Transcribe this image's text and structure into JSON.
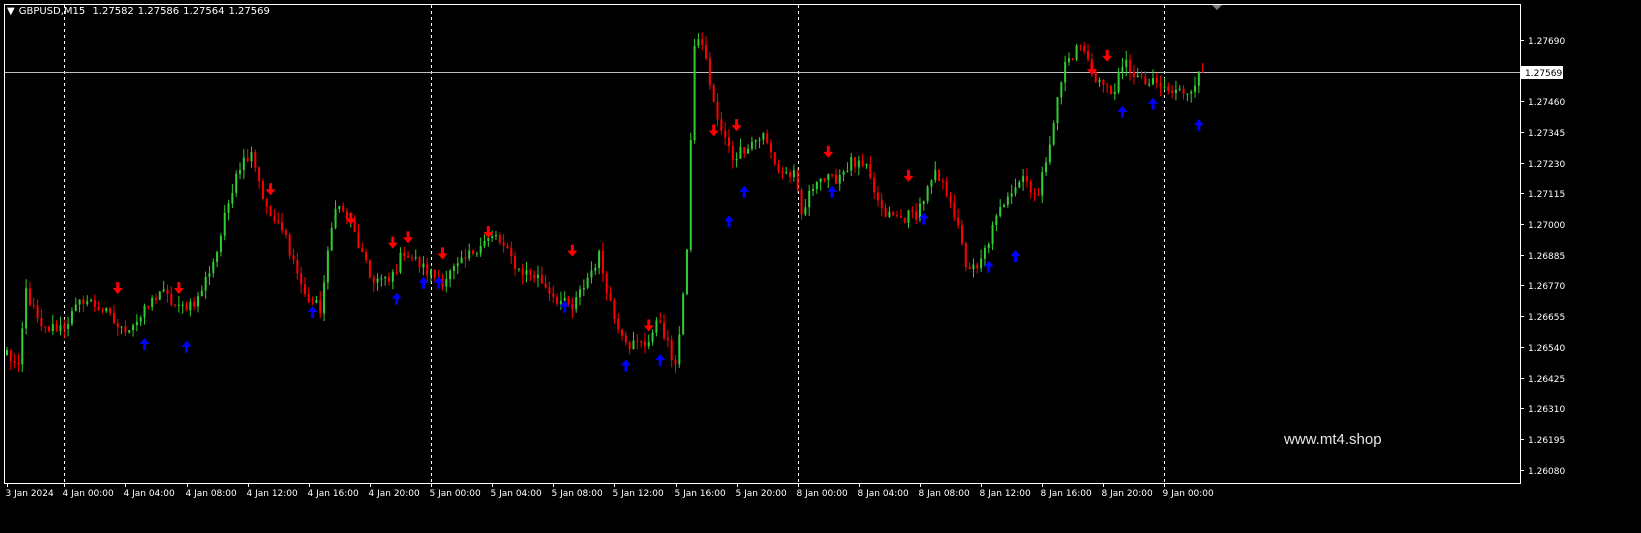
{
  "header": {
    "symbol": "GBPUSD,M15",
    "open": "1.27582",
    "high": "1.27586",
    "low": "1.27564",
    "close": "1.27569"
  },
  "watermark": "www.mt4.shop",
  "colors": {
    "background": "#000000",
    "bull": "#32cd32",
    "bear": "#ff0000",
    "up_arrow": "#0000ff",
    "down_arrow": "#ff0000",
    "frame": "#ffffff",
    "grid": "#ffffff",
    "price_line": "#c0c0c0"
  },
  "chart_data": {
    "type": "candlestick",
    "symbol": "GBPUSD",
    "timeframe": "M15",
    "ylim": [
      1.2603,
      1.2782
    ],
    "y_ticks": [
      "1.27690",
      "1.27460",
      "1.27345",
      "1.27230",
      "1.27115",
      "1.27000",
      "1.26885",
      "1.26770",
      "1.26655",
      "1.26540",
      "1.26425",
      "1.26310",
      "1.26195",
      "1.26080"
    ],
    "current_price": "1.27569",
    "x_labels": [
      "3 Jan 2024",
      "4 Jan 00:00",
      "4 Jan 04:00",
      "4 Jan 08:00",
      "4 Jan 12:00",
      "4 Jan 16:00",
      "4 Jan 20:00",
      "5 Jan 00:00",
      "5 Jan 04:00",
      "5 Jan 08:00",
      "5 Jan 12:00",
      "5 Jan 16:00",
      "5 Jan 20:00",
      "8 Jan 00:00",
      "8 Jan 04:00",
      "8 Jan 08:00",
      "8 Jan 12:00",
      "8 Jan 16:00",
      "8 Jan 20:00",
      "9 Jan 00:00"
    ],
    "x_label_bars": [
      0,
      15,
      31,
      47,
      63,
      79,
      95,
      111,
      127,
      143,
      159,
      175,
      191,
      207,
      223,
      239,
      255,
      271,
      287,
      303
    ],
    "day_separator_bars": [
      15,
      111,
      207,
      303
    ],
    "total_bar_slots": 400,
    "path": [
      [
        0,
        1.2652
      ],
      [
        3,
        1.2645
      ],
      [
        5,
        1.2675
      ],
      [
        9,
        1.266
      ],
      [
        15,
        1.2662
      ],
      [
        20,
        1.2672
      ],
      [
        25,
        1.2668
      ],
      [
        30,
        1.266
      ],
      [
        35,
        1.2665
      ],
      [
        40,
        1.2675
      ],
      [
        45,
        1.2668
      ],
      [
        50,
        1.2672
      ],
      [
        55,
        1.269
      ],
      [
        60,
        1.272
      ],
      [
        64,
        1.2728
      ],
      [
        68,
        1.2705
      ],
      [
        73,
        1.2695
      ],
      [
        78,
        1.2673
      ],
      [
        82,
        1.2668
      ],
      [
        86,
        1.2708
      ],
      [
        90,
        1.27
      ],
      [
        95,
        1.268
      ],
      [
        100,
        1.2678
      ],
      [
        104,
        1.269
      ],
      [
        110,
        1.2682
      ],
      [
        114,
        1.2679
      ],
      [
        119,
        1.2685
      ],
      [
        124,
        1.2693
      ],
      [
        128,
        1.2695
      ],
      [
        134,
        1.2683
      ],
      [
        139,
        1.268
      ],
      [
        144,
        1.2672
      ],
      [
        148,
        1.2668
      ],
      [
        152,
        1.268
      ],
      [
        155,
        1.2688
      ],
      [
        159,
        1.2665
      ],
      [
        163,
        1.2655
      ],
      [
        167,
        1.2655
      ],
      [
        171,
        1.2664
      ],
      [
        175,
        1.2645
      ],
      [
        178,
        1.269
      ],
      [
        180,
        1.2768
      ],
      [
        182,
        1.2768
      ],
      [
        186,
        1.2738
      ],
      [
        190,
        1.2725
      ],
      [
        194,
        1.273
      ],
      [
        198,
        1.2733
      ],
      [
        202,
        1.272
      ],
      [
        206,
        1.2718
      ],
      [
        208,
        1.2703
      ],
      [
        212,
        1.2718
      ],
      [
        216,
        1.2716
      ],
      [
        221,
        1.2723
      ],
      [
        225,
        1.272
      ],
      [
        229,
        1.2704
      ],
      [
        234,
        1.2702
      ],
      [
        238,
        1.2704
      ],
      [
        243,
        1.2718
      ],
      [
        247,
        1.271
      ],
      [
        251,
        1.2685
      ],
      [
        254,
        1.2682
      ],
      [
        258,
        1.2698
      ],
      [
        262,
        1.2712
      ],
      [
        266,
        1.2718
      ],
      [
        270,
        1.271
      ],
      [
        273,
        1.2732
      ],
      [
        277,
        1.276
      ],
      [
        281,
        1.2767
      ],
      [
        285,
        1.2755
      ],
      [
        289,
        1.2749
      ],
      [
        293,
        1.276
      ],
      [
        297,
        1.2753
      ],
      [
        301,
        1.2752
      ],
      [
        305,
        1.2749
      ],
      [
        309,
        1.275
      ],
      [
        313,
        1.2757
      ]
    ],
    "up_arrows": [
      [
        36,
        1.2655
      ],
      [
        47,
        1.2654
      ],
      [
        80,
        1.2667
      ],
      [
        102,
        1.2672
      ],
      [
        109,
        1.2678
      ],
      [
        113,
        1.2678
      ],
      [
        146,
        1.2669
      ],
      [
        162,
        1.2647
      ],
      [
        171,
        1.2649
      ],
      [
        189,
        1.2701
      ],
      [
        193,
        1.2712
      ],
      [
        216,
        1.2712
      ],
      [
        240,
        1.2702
      ],
      [
        257,
        1.2684
      ],
      [
        264,
        1.2688
      ],
      [
        292,
        1.2742
      ],
      [
        300,
        1.2745
      ],
      [
        312,
        1.2737
      ]
    ],
    "down_arrows": [
      [
        29,
        1.2676
      ],
      [
        45,
        1.2676
      ],
      [
        69,
        1.2713
      ],
      [
        90,
        1.2702
      ],
      [
        101,
        1.2693
      ],
      [
        105,
        1.2695
      ],
      [
        114,
        1.2689
      ],
      [
        126,
        1.2697
      ],
      [
        148,
        1.269
      ],
      [
        168,
        1.2662
      ],
      [
        185,
        1.2735
      ],
      [
        191,
        1.2737
      ],
      [
        215,
        1.2727
      ],
      [
        236,
        1.2718
      ],
      [
        284,
        1.2758
      ],
      [
        288,
        1.2763
      ]
    ]
  }
}
